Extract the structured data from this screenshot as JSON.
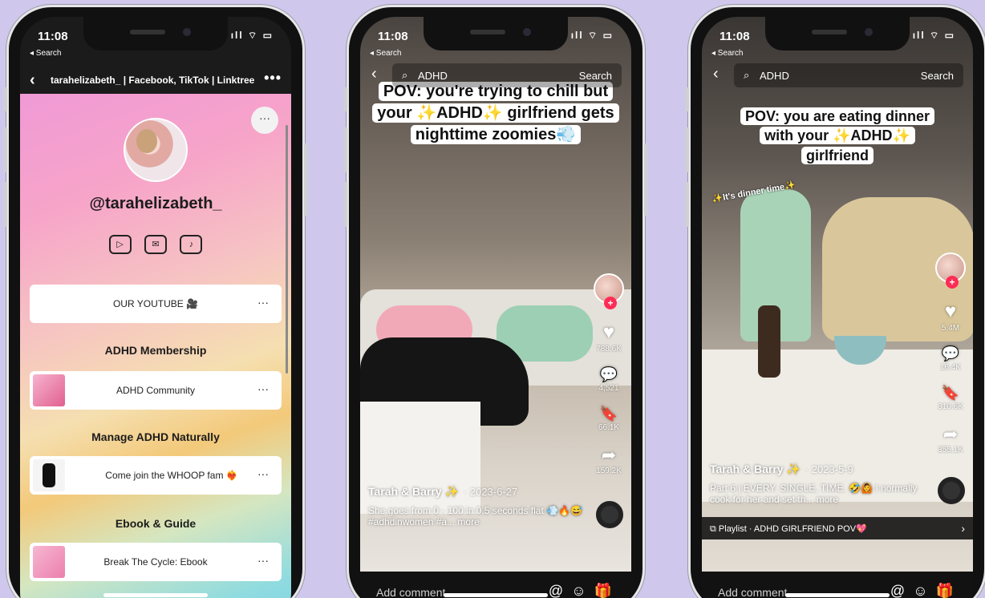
{
  "status": {
    "time": "11:08",
    "back_label": "◂ Search",
    "indicators": "ıll ⌔ ▭"
  },
  "phone1": {
    "header_title": "tarahelizabeth_ | Facebook, TikTok | Linktree",
    "more": "•••",
    "menu": "···",
    "handle": "@tarahelizabeth_",
    "socials": [
      "▷",
      "✉",
      "♪"
    ],
    "buttons": [
      {
        "label": "OUR YOUTUBE 🎥",
        "dots": "···"
      },
      {
        "label": "ADHD Community",
        "dots": "···"
      },
      {
        "label": "Come join the WHOOP fam ❤️‍🔥",
        "dots": "···"
      },
      {
        "label": "Break The Cycle: Ebook",
        "dots": "···"
      }
    ],
    "sections": [
      "ADHD Membership",
      "Manage ADHD Naturally",
      "Ebook & Guide"
    ]
  },
  "phone2": {
    "search_query": "ADHD",
    "search_btn": "Search",
    "caption": "POV: you're trying to chill but your ✨ADHD✨ girlfriend gets nighttime zoomies💨",
    "likes": "788.6K",
    "comments": "4,521",
    "saves": "66.1K",
    "shares": "159.2K",
    "author": "Tarah & Barry ✨",
    "date": "· 2023-6-27",
    "desc": "She goes from 0 - 100 in 0.5 seconds flat 💨🔥😅 #adhdinwomen #a... more",
    "comment_placeholder": "Add comment..."
  },
  "phone3": {
    "search_query": "ADHD",
    "search_btn": "Search",
    "caption": "POV: you are eating dinner with your ✨ADHD✨ girlfriend",
    "overlay": "✨It's dinner time✨",
    "likes": "5.4M",
    "comments": "16.4K",
    "saves": "310.6K",
    "shares": "355.1K",
    "author": "Tarah & Barry ✨",
    "date": "· 2023-5-9",
    "desc": "Part 6 | EVERY. SINGLE. TIME. 🤣🙆 I normally cook for her and set th... more",
    "playlist": "⧉ Playlist · ADHD GIRLFRIEND POV💖",
    "comment_placeholder": "Add comment..."
  },
  "icons": {
    "back": "‹",
    "search": "⌕",
    "heart": "♥",
    "comment": "💬",
    "save": "🔖",
    "share": "➦",
    "at": "@",
    "emoji": "☺",
    "gift": "🎁",
    "chevron": "›"
  },
  "colors": {
    "background": "#cfc8ec",
    "tiktok_red": "#fe2c55"
  }
}
